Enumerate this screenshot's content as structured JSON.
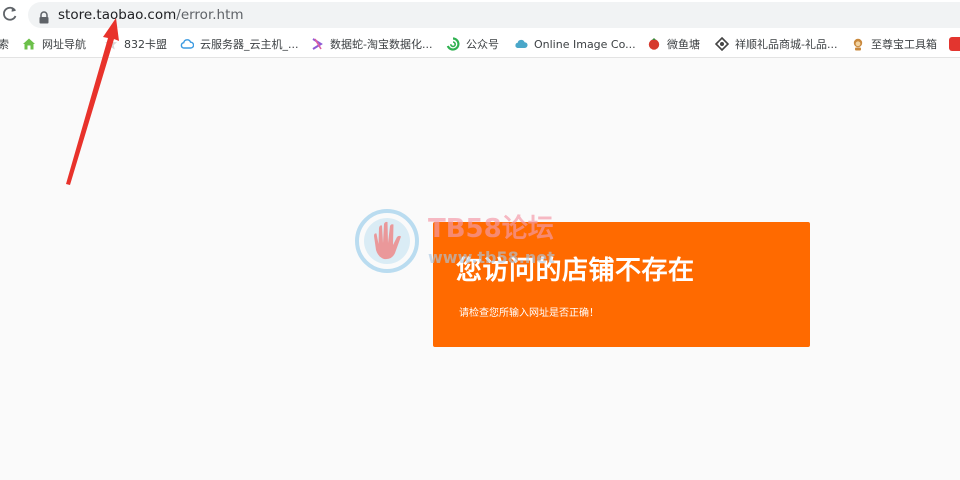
{
  "browser": {
    "address": {
      "host": "store.taobao.com",
      "path": "/error.htm"
    },
    "bookmarks": [
      {
        "label": "索",
        "icon": "search-icon"
      },
      {
        "label": "网址导航",
        "icon": "house-icon"
      },
      {
        "label": "832卡盟",
        "icon": "star-icon"
      },
      {
        "label": "云服务器_云主机_...",
        "icon": "cloud-icon"
      },
      {
        "label": "数据蛇-淘宝数据化...",
        "icon": "snake-icon"
      },
      {
        "label": "公众号",
        "icon": "wechat-icon"
      },
      {
        "label": "Online Image Co...",
        "icon": "image-converter-icon"
      },
      {
        "label": "微鱼塘",
        "icon": "fish-icon"
      },
      {
        "label": "祥顺礼品商城-礼品...",
        "icon": "gift-icon"
      },
      {
        "label": "至尊宝工具箱",
        "icon": "monkey-icon"
      }
    ]
  },
  "error": {
    "title": "您访问的店铺不存在",
    "message": "请检查您所输入网址是否正确！"
  },
  "watermark": {
    "brand": "TB58论坛",
    "site": "www.tb58.net"
  },
  "colors": {
    "error_card": "#ff6a00",
    "arrow": "#e8322b"
  }
}
